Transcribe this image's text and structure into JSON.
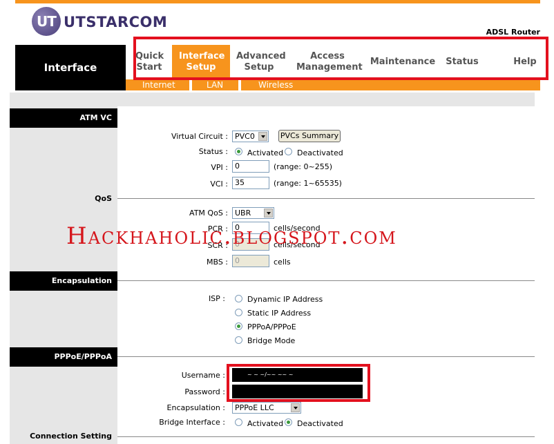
{
  "brand": {
    "logo_text": "UTSTARCOM",
    "logo_mark": "UT",
    "model": "ADSL Router"
  },
  "colors": {
    "accent": "#f7941d",
    "highlight_box": "#e3101e",
    "watermark": "#d5161c",
    "panel": "#e6e6e6"
  },
  "nav": {
    "section_title": "Interface",
    "items": [
      {
        "label": "Quick Start"
      },
      {
        "label": "Interface Setup",
        "active": true
      },
      {
        "label": "Advanced Setup"
      },
      {
        "label": "Access Management"
      },
      {
        "label": "Maintenance"
      },
      {
        "label": "Status"
      },
      {
        "label": "Help"
      }
    ],
    "subitems": [
      {
        "label": "Internet"
      },
      {
        "label": "LAN"
      },
      {
        "label": "Wireless"
      }
    ]
  },
  "atm_vc": {
    "heading": "ATM VC",
    "virtual_circuit_label": "Virtual Circuit :",
    "virtual_circuit_value": "PVC0",
    "pvcs_summary_button": "PVCs Summary",
    "status_label": "Status :",
    "status_activated": "Activated",
    "status_deactivated": "Deactivated",
    "status_selected": "Activated",
    "vpi_label": "VPI :",
    "vpi_value": "0",
    "vpi_range": "(range: 0~255)",
    "vci_label": "VCI :",
    "vci_value": "35",
    "vci_range": "(range: 1~65535)"
  },
  "qos": {
    "heading": "QoS",
    "atm_qos_label": "ATM QoS :",
    "atm_qos_value": "UBR",
    "pcr_label": "PCR :",
    "pcr_value": "0",
    "pcr_unit": "cells/second",
    "scr_label": "SCR :",
    "scr_value": "0",
    "scr_unit": "cells/second",
    "mbs_label": "MBS :",
    "mbs_value": "0",
    "mbs_unit": "cells"
  },
  "encapsulation": {
    "heading": "Encapsulation",
    "isp_label": "ISP :",
    "options": [
      "Dynamic IP Address",
      "Static IP Address",
      "PPPoA/PPPoE",
      "Bridge Mode"
    ],
    "selected": "PPPoA/PPPoE"
  },
  "pppoe": {
    "heading": "PPPoE/PPPoA",
    "username_label": "Username :",
    "username_value": "~ ~        ~/~~ ~~ ~",
    "password_label": "Password :",
    "encapsulation_label": "Encapsulation :",
    "encapsulation_value": "PPPoE LLC",
    "bridge_label": "Bridge Interface :",
    "bridge_activated": "Activated",
    "bridge_deactivated": "Deactivated",
    "bridge_selected": "Deactivated"
  },
  "connection": {
    "heading": "Connection Setting"
  },
  "watermark": "Hackhaholic.blogspot.com"
}
